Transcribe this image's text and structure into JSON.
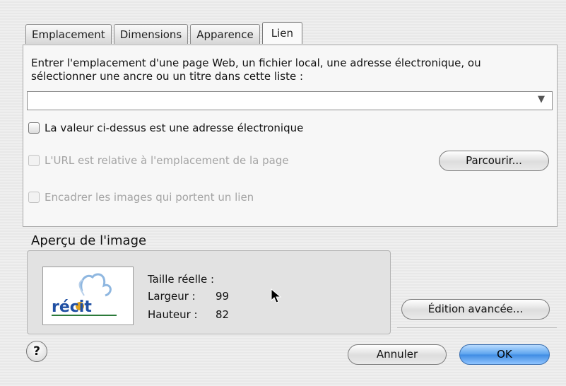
{
  "tabs": [
    "Emplacement",
    "Dimensions",
    "Apparence",
    "Lien"
  ],
  "link_panel": {
    "description": "Entrer l'emplacement d'une page Web, un fichier local, une adresse électronique, ou sélectionner une ancre ou un titre dans cette liste :",
    "combo_value": "",
    "checkbox_email": "La valeur ci-dessus est une adresse électronique",
    "checkbox_relative": "L'URL est relative à l'emplacement de la page",
    "checkbox_border": "Encadrer les images qui portent un lien",
    "browse_button": "Parcourir..."
  },
  "preview": {
    "title": "Aperçu de l'image",
    "size_label": "Taille réelle :",
    "width_label": "Largeur :",
    "width_value": "99",
    "height_label": "Hauteur :",
    "height_value": "82",
    "logo_text": "récit",
    "advanced_button": "Édition avancée..."
  },
  "footer": {
    "help_label": "?",
    "cancel_button": "Annuler",
    "ok_button": "OK"
  },
  "colors": {
    "ok_accent": "#4a93e6",
    "panel_bg": "#f7f7f7",
    "disabled_text": "#a4a4a4"
  },
  "icons": [
    "chevron-down-icon",
    "help-icon",
    "cursor-icon",
    "recit-logo"
  ]
}
